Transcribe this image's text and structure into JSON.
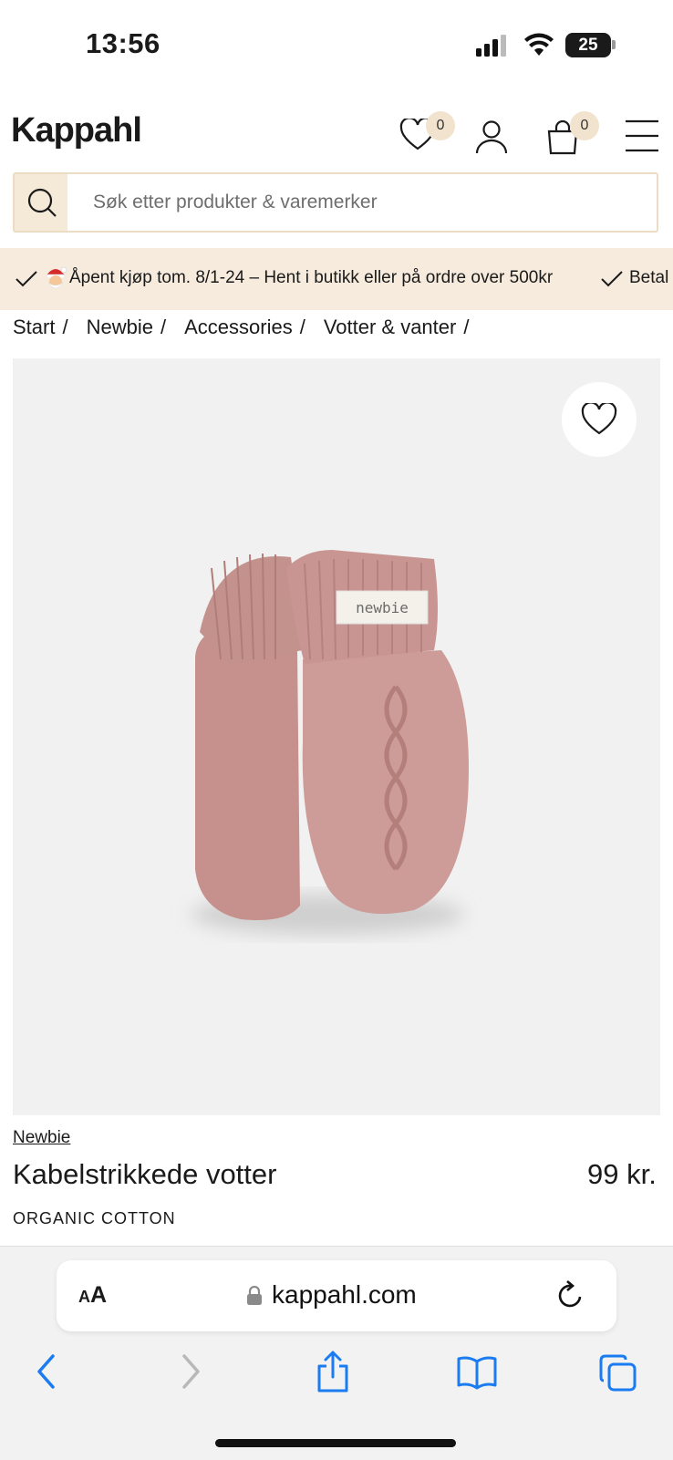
{
  "status_bar": {
    "time": "13:56",
    "battery": "25"
  },
  "header": {
    "logo": "Kappahl",
    "wishlist_count": "0",
    "cart_count": "0"
  },
  "search": {
    "placeholder": "Søk etter produkter & varemerker"
  },
  "promo": {
    "item1": "Åpent kjøp tom. 8/1-24 – Hent i butikk eller på ordre over 500kr",
    "item2": "Betal s"
  },
  "breadcrumb": [
    {
      "label": "Start"
    },
    {
      "label": "Newbie"
    },
    {
      "label": "Accessories"
    },
    {
      "label": "Votter & vanter"
    }
  ],
  "breadcrumb_separator": "/",
  "product": {
    "image_label": "newbie",
    "brand": "Newbie",
    "name": "Kabelstrikkede votter",
    "price": "99 kr.",
    "tagline": "ORGANIC COTTON"
  },
  "browser": {
    "aa_small": "A",
    "aa_large": "A",
    "url": "kappahl.com"
  },
  "colors": {
    "accent_beige": "#f6ebdd",
    "badge": "#f2e3cf",
    "safari_blue": "#1a7cf0",
    "mitten_pink": "#c99a96"
  }
}
